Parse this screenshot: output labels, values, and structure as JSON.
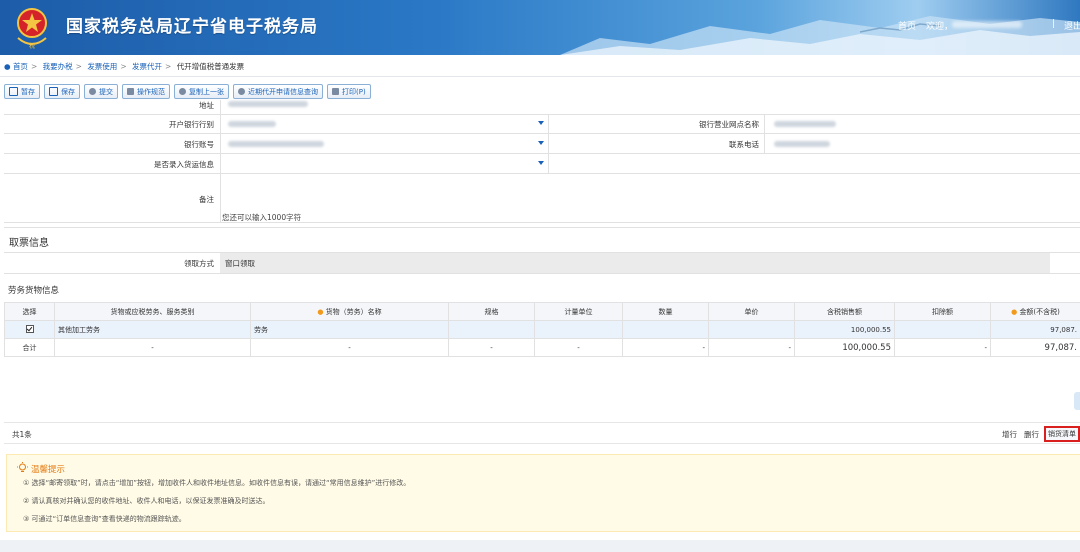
{
  "header": {
    "site_title": "国家税务总局辽宁省电子税务局",
    "home_link": "首页",
    "welcome": "欢迎，",
    "logout": "退出"
  },
  "breadcrumb": {
    "items": [
      "首页",
      "我要办税",
      "发票使用",
      "发票代开",
      "代开增值税普通发票"
    ]
  },
  "toolbar": {
    "buttons": [
      "暂存",
      "保存",
      "提交",
      "操作规范",
      "复制上一张",
      "近期代开申请信息查询",
      "打印(P)"
    ]
  },
  "form": {
    "address_label": "地址",
    "bank_label": "开户银行行别",
    "bank_branch_label": "银行营业网点名称",
    "account_label": "银行账号",
    "phone_label": "联系电话",
    "freight_label": "是否录入货运信息",
    "remark_label": "备注",
    "remark_hint": "您还可以输入1000字符"
  },
  "pickup": {
    "section_title": "取票信息",
    "method_label": "领取方式",
    "method_value": "窗口领取"
  },
  "goods": {
    "section_title": "劳务货物信息",
    "columns": [
      "选择",
      "货物或应税劳务、服务类别",
      "货物（劳务）名称",
      "规格",
      "计量单位",
      "数量",
      "单价",
      "含税销售额",
      "扣除额",
      "金额(不含税)"
    ],
    "row": {
      "category": "其他加工劳务",
      "name": "劳务",
      "spec": "",
      "unit": "",
      "qty": "",
      "price": "",
      "sales_incl_tax": "100,000.55",
      "deduction": "",
      "amount": "97,087."
    },
    "total_row": {
      "label": "合计",
      "dash": "-",
      "sales_incl_tax": "100,000.55",
      "amount": "97,087."
    },
    "count": "共1条",
    "add_row": "增行",
    "delete_row": "删行",
    "sales_list": "销货清单"
  },
  "tips": {
    "title": "温馨提示",
    "lines": [
      "① 选择“邮寄领取”时，请点击“增加”按钮，增加收件人和收件地址信息。如收件信息有误，请通过“常用信息维护”进行修改。",
      "② 请认真核对并确认您的收件地址、收件人和电话，以保证发票准确及时送达。",
      "③ 可通过“订单信息查询”查看快递的物流跟踪轨迹。"
    ]
  },
  "colors": {
    "header_blue": "#2a78c6",
    "link_blue": "#1a62b8",
    "tip_orange": "#e47a12",
    "tip_bg": "#fffbe6",
    "highlight_red": "#d9201f",
    "required_star": "#f29a1c"
  }
}
